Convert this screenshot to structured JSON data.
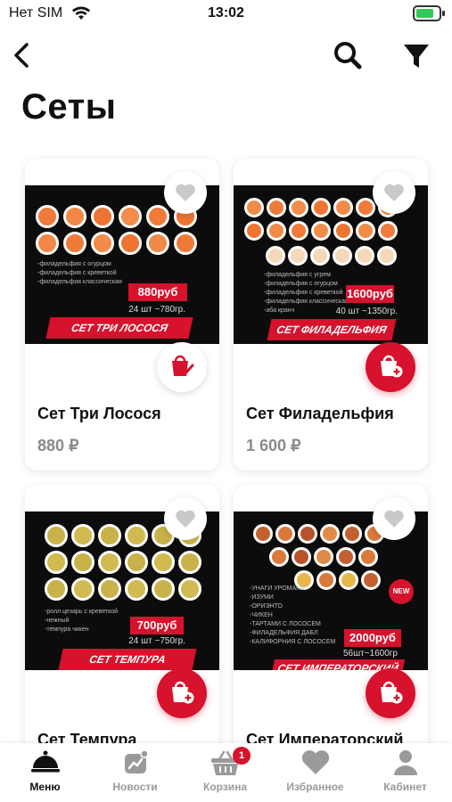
{
  "status_bar": {
    "carrier": "Нет SIM",
    "time": "13:02",
    "battery_level": 0.8
  },
  "page": {
    "title": "Сеты"
  },
  "products": [
    {
      "name": "Сет Три Лосося",
      "price": "880 ₽",
      "banner": "СЕТ ТРИ ЛОСОСЯ",
      "tag_price": "880руб",
      "qty": "24 шт ~780гр.",
      "in_cart": true,
      "desc": [
        "-филадельфия с огурцом",
        "-филадельфия с креветкой",
        "-филадельфия классическая"
      ]
    },
    {
      "name": "Сет Филадельфия",
      "price": "1 600 ₽",
      "banner": "СЕТ ФИЛАДЕЛЬФИЯ",
      "tag_price": "1600руб",
      "qty": "40 шт ~1350гр.",
      "in_cart": false,
      "desc": [
        "-филадельфия с угрем",
        "-филадельфия с огурцом",
        "-филадельфия с креветкой",
        "-филадельфия классическая",
        "-аба кранч"
      ]
    },
    {
      "name": "Сет Темпура",
      "price": "",
      "banner": "СЕТ ТЕМПУРА",
      "tag_price": "700руб",
      "qty": "24 шт ~750гр.",
      "in_cart": false,
      "desc": [
        "-ролл цезарь с креветкой",
        "-нежный",
        "-темпура чикен"
      ]
    },
    {
      "name": "Сет Императорский",
      "price": "",
      "banner": "СЕТ ИМПЕРАТОРСКИЙ",
      "tag_price": "2000руб",
      "qty": "56шт~1600гр",
      "in_cart": false,
      "new_badge": "NEW",
      "desc": [
        "-УНАГИ УРОМАКИ",
        "-ИЗУМИ",
        "-ОРИЭНТО",
        "-ЧИКЕН",
        "-ТАРТАМИ С ЛОСОСЕМ",
        "-ФИЛАДЕЛЬФИЯ ДАБЛ",
        "-КАЛИФОРНИЯ С ЛОСОСЕМ"
      ]
    }
  ],
  "tabs": [
    {
      "label": "Меню",
      "icon": "cloche-icon",
      "active": true
    },
    {
      "label": "Новости",
      "icon": "news-icon",
      "active": false
    },
    {
      "label": "Корзина",
      "icon": "basket-icon",
      "active": false,
      "badge": "1"
    },
    {
      "label": "Избранное",
      "icon": "heart-icon",
      "active": false
    },
    {
      "label": "Кабинет",
      "icon": "user-icon",
      "active": false
    }
  ],
  "colors": {
    "accent": "#d6122c",
    "muted_price": "#8a8a8a",
    "tab_inactive": "#9a9a9a"
  }
}
